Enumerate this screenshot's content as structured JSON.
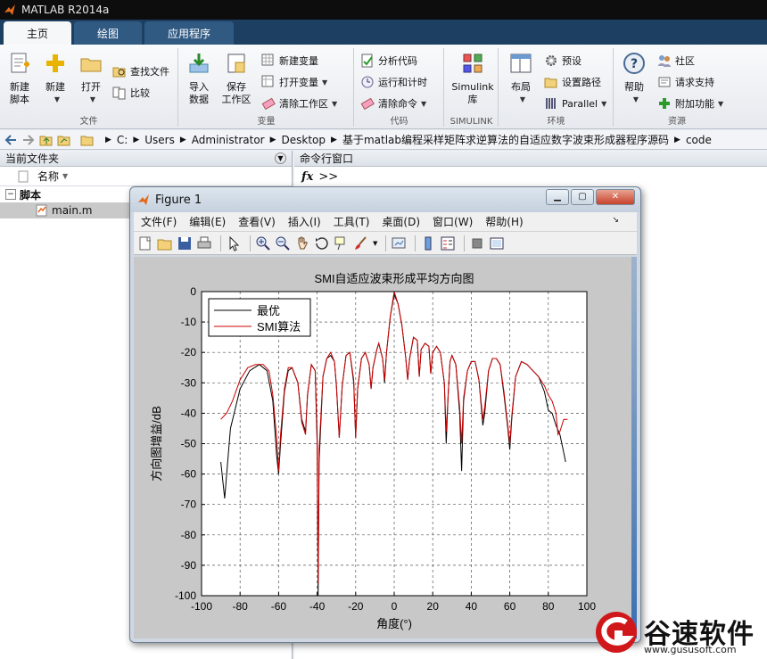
{
  "app": {
    "title": "MATLAB R2014a"
  },
  "ribbon": {
    "tabs": [
      {
        "label": "主页",
        "active": true
      },
      {
        "label": "绘图",
        "active": false
      },
      {
        "label": "应用程序",
        "active": false
      }
    ],
    "file_group": {
      "label": "文件",
      "new_script": "新建\n脚本",
      "new": "新建",
      "open": "打开",
      "find_files": "查找文件",
      "compare": "比较"
    },
    "variable_group": {
      "label": "变量",
      "import": "导入\n数据",
      "save_workspace": "保存\n工作区",
      "new_variable": "新建变量",
      "open_variable": "打开变量",
      "clear_workspace": "清除工作区"
    },
    "code_group": {
      "label": "代码",
      "analyze": "分析代码",
      "run_time": "运行和计时",
      "clear_commands": "清除命令"
    },
    "simulink_group": {
      "label": "SIMULINK",
      "simulink": "Simulink\n库"
    },
    "env_group": {
      "label": "环境",
      "layout": "布局",
      "preferences": "预设",
      "set_path": "设置路径",
      "parallel": "Parallel"
    },
    "resources_group": {
      "label": "资源",
      "help": "帮助",
      "community": "社区",
      "request_support": "请求支持",
      "addons": "附加功能"
    }
  },
  "address": {
    "crumbs": [
      "C:",
      "Users",
      "Administrator",
      "Desktop",
      "基于matlab编程采样矩阵求逆算法的自适应数字波束形成器程序源码",
      "code"
    ]
  },
  "left_panel": {
    "title": "当前文件夹",
    "column": "名称",
    "group_label": "脚本",
    "files": [
      "main.m"
    ]
  },
  "command_window": {
    "title": "命令行窗口",
    "prompt": ">>",
    "fx": "fx"
  },
  "figure": {
    "title": "Figure 1",
    "menu": [
      "文件(F)",
      "编辑(E)",
      "查看(V)",
      "插入(I)",
      "工具(T)",
      "桌面(D)",
      "窗口(W)",
      "帮助(H)"
    ]
  },
  "chart_data": {
    "type": "line",
    "title": "SMI自适应波束形成平均方向图",
    "xlabel": "角度(°)",
    "ylabel": "方向图增益/dB",
    "xlim": [
      -100,
      100
    ],
    "ylim": [
      -100,
      0
    ],
    "xticks": [
      -100,
      -80,
      -60,
      -40,
      -20,
      0,
      20,
      40,
      60,
      80,
      100
    ],
    "yticks": [
      0,
      -10,
      -20,
      -30,
      -40,
      -50,
      -60,
      -70,
      -80,
      -90,
      -100
    ],
    "grid": true,
    "legend_position": "top-left",
    "series": [
      {
        "name": "最优",
        "color": "#000000",
        "points": [
          [
            -90,
            -56
          ],
          [
            -88,
            -68
          ],
          [
            -85,
            -45
          ],
          [
            -80,
            -32
          ],
          [
            -75,
            -26
          ],
          [
            -70,
            -24
          ],
          [
            -66,
            -26
          ],
          [
            -63,
            -36
          ],
          [
            -61,
            -54
          ],
          [
            -60,
            -60
          ],
          [
            -59,
            -50
          ],
          [
            -57,
            -33
          ],
          [
            -55,
            -26
          ],
          [
            -53,
            -25
          ],
          [
            -50,
            -30
          ],
          [
            -48,
            -42
          ],
          [
            -46,
            -46
          ],
          [
            -45,
            -34
          ],
          [
            -43,
            -24
          ],
          [
            -41,
            -26
          ],
          [
            -40,
            -50
          ],
          [
            -39.5,
            -100
          ],
          [
            -39,
            -56
          ],
          [
            -37,
            -28
          ],
          [
            -35,
            -22
          ],
          [
            -33,
            -21
          ],
          [
            -31,
            -23
          ],
          [
            -30,
            -31
          ],
          [
            -28.5,
            -48
          ],
          [
            -27,
            -31
          ],
          [
            -25,
            -21
          ],
          [
            -23,
            -20
          ],
          [
            -21,
            -30
          ],
          [
            -20,
            -48
          ],
          [
            -19,
            -32
          ],
          [
            -17,
            -22
          ],
          [
            -15,
            -20
          ],
          [
            -13,
            -24
          ],
          [
            -12,
            -32
          ],
          [
            -11,
            -25
          ],
          [
            -9,
            -19
          ],
          [
            -8,
            -17
          ],
          [
            -6,
            -22
          ],
          [
            -5,
            -30
          ],
          [
            -4,
            -20
          ],
          [
            -2,
            -8
          ],
          [
            0,
            -1
          ],
          [
            2,
            -4
          ],
          [
            4,
            -11
          ],
          [
            6,
            -22
          ],
          [
            7,
            -29
          ],
          [
            8,
            -22
          ],
          [
            10,
            -15
          ],
          [
            12,
            -16
          ],
          [
            13,
            -28
          ],
          [
            14,
            -19
          ],
          [
            16,
            -17
          ],
          [
            18,
            -18
          ],
          [
            19,
            -27
          ],
          [
            20,
            -20
          ],
          [
            22,
            -18
          ],
          [
            24,
            -20
          ],
          [
            26,
            -30
          ],
          [
            27,
            -50
          ],
          [
            28,
            -34
          ],
          [
            29,
            -23
          ],
          [
            30,
            -21
          ],
          [
            32,
            -24
          ],
          [
            34,
            -40
          ],
          [
            35,
            -59
          ],
          [
            36,
            -36
          ],
          [
            38,
            -26
          ],
          [
            40,
            -23
          ],
          [
            42,
            -23
          ],
          [
            44,
            -29
          ],
          [
            46,
            -44
          ],
          [
            47,
            -40
          ],
          [
            49,
            -26
          ],
          [
            51,
            -22
          ],
          [
            53,
            -22
          ],
          [
            55,
            -24
          ],
          [
            57,
            -34
          ],
          [
            59,
            -45
          ],
          [
            60,
            -52
          ],
          [
            61,
            -42
          ],
          [
            63,
            -28
          ],
          [
            66,
            -23
          ],
          [
            69,
            -24
          ],
          [
            72,
            -26
          ],
          [
            75,
            -28
          ],
          [
            78,
            -33
          ],
          [
            80,
            -39
          ],
          [
            82,
            -40
          ],
          [
            84,
            -44
          ],
          [
            86,
            -47
          ],
          [
            88,
            -53
          ],
          [
            89,
            -56
          ]
        ]
      },
      {
        "name": "SMI算法",
        "color": "#cc0000",
        "points": [
          [
            -90,
            -42
          ],
          [
            -87,
            -40
          ],
          [
            -84,
            -36
          ],
          [
            -80,
            -29
          ],
          [
            -76,
            -25
          ],
          [
            -72,
            -24
          ],
          [
            -68,
            -24
          ],
          [
            -65,
            -26
          ],
          [
            -63,
            -34
          ],
          [
            -61,
            -48
          ],
          [
            -60,
            -59
          ],
          [
            -59,
            -47
          ],
          [
            -57,
            -32
          ],
          [
            -55,
            -25
          ],
          [
            -53,
            -25
          ],
          [
            -50,
            -30
          ],
          [
            -48,
            -43
          ],
          [
            -46,
            -47
          ],
          [
            -45,
            -34
          ],
          [
            -43,
            -24
          ],
          [
            -41,
            -26
          ],
          [
            -40,
            -46
          ],
          [
            -39.5,
            -96
          ],
          [
            -39,
            -52
          ],
          [
            -37,
            -28
          ],
          [
            -35,
            -22
          ],
          [
            -33,
            -20
          ],
          [
            -31,
            -23
          ],
          [
            -30,
            -31
          ],
          [
            -28.5,
            -48
          ],
          [
            -27,
            -31
          ],
          [
            -25,
            -21
          ],
          [
            -23,
            -20
          ],
          [
            -21,
            -29
          ],
          [
            -20,
            -48
          ],
          [
            -19,
            -32
          ],
          [
            -17,
            -22
          ],
          [
            -15,
            -20
          ],
          [
            -13,
            -24
          ],
          [
            -12,
            -32
          ],
          [
            -11,
            -25
          ],
          [
            -9,
            -19
          ],
          [
            -8,
            -17
          ],
          [
            -6,
            -22
          ],
          [
            -5,
            -29
          ],
          [
            -4,
            -20
          ],
          [
            -2,
            -8
          ],
          [
            0,
            0
          ],
          [
            2,
            -4
          ],
          [
            4,
            -11
          ],
          [
            6,
            -22
          ],
          [
            7,
            -29
          ],
          [
            8,
            -22
          ],
          [
            10,
            -15
          ],
          [
            12,
            -16
          ],
          [
            13,
            -28
          ],
          [
            14,
            -19
          ],
          [
            16,
            -17
          ],
          [
            18,
            -18
          ],
          [
            19,
            -27
          ],
          [
            20,
            -20
          ],
          [
            22,
            -18
          ],
          [
            24,
            -20
          ],
          [
            26,
            -30
          ],
          [
            27,
            -46
          ],
          [
            28,
            -34
          ],
          [
            29,
            -23
          ],
          [
            30,
            -21
          ],
          [
            32,
            -24
          ],
          [
            34,
            -38
          ],
          [
            35,
            -50
          ],
          [
            36,
            -35
          ],
          [
            38,
            -26
          ],
          [
            40,
            -23
          ],
          [
            42,
            -23
          ],
          [
            44,
            -29
          ],
          [
            46,
            -42
          ],
          [
            47,
            -38
          ],
          [
            49,
            -26
          ],
          [
            51,
            -22
          ],
          [
            53,
            -22
          ],
          [
            55,
            -24
          ],
          [
            57,
            -33
          ],
          [
            59,
            -44
          ],
          [
            60,
            -50
          ],
          [
            61,
            -41
          ],
          [
            63,
            -28
          ],
          [
            66,
            -23
          ],
          [
            69,
            -24
          ],
          [
            72,
            -26
          ],
          [
            75,
            -28
          ],
          [
            78,
            -31
          ],
          [
            80,
            -34
          ],
          [
            82,
            -36
          ],
          [
            84,
            -40
          ],
          [
            85,
            -47
          ],
          [
            86,
            -46
          ],
          [
            88,
            -42
          ],
          [
            90,
            -42
          ]
        ]
      }
    ]
  },
  "watermark": {
    "title": "谷速软件",
    "url": "www.gususoft.com"
  }
}
